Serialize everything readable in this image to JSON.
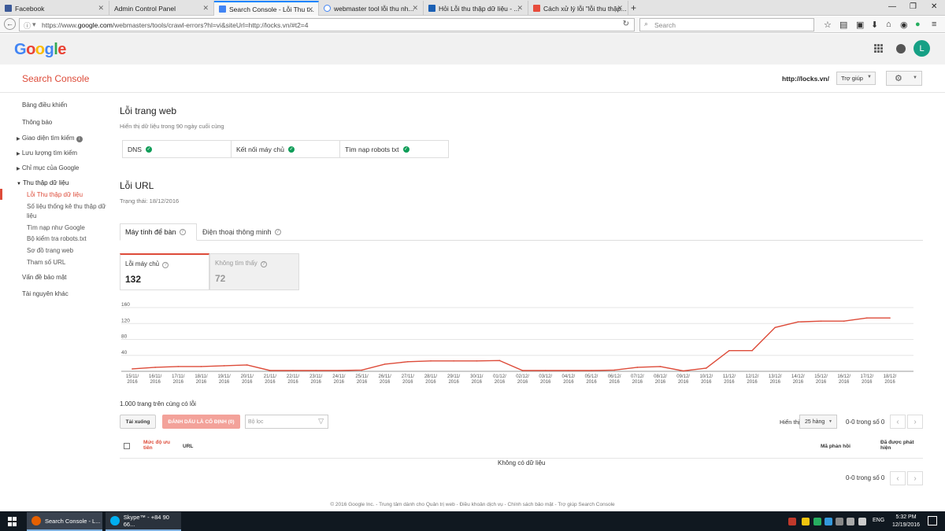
{
  "browser": {
    "tabs": [
      {
        "label": "Facebook",
        "color": "#3b5998"
      },
      {
        "label": "Admin Control Panel",
        "color": ""
      },
      {
        "label": "Search Console - Lỗi Thu t...",
        "color": "#4285f4"
      },
      {
        "label": "webmaster tool lỗi thu nh...",
        "color": "#4285f4"
      },
      {
        "label": "Hỏi Lỗi thu thập dữ liệu - ...",
        "color": "#1a5fb4"
      },
      {
        "label": "Cách xử lý lỗi \"lỗi thu thập...",
        "color": "#e74c3c"
      }
    ],
    "url_prefix": "https://www.",
    "url_host": "google.com",
    "url_rest": "/webmasters/tools/crawl-errors?hl=vi&siteUrl=http://locks.vn/#t2=4",
    "search_placeholder": "Search"
  },
  "google": {
    "logo": "Google",
    "avatar_letter": "L"
  },
  "sc": {
    "title": "Search Console",
    "site": "http://locks.vn/",
    "help": "Trợ giúp"
  },
  "sidebar": {
    "items": [
      {
        "label": "Bảng điều khiển"
      },
      {
        "label": "Thông báo"
      },
      {
        "label": "Giao diện tìm kiếm"
      },
      {
        "label": "Lưu lượng tìm kiếm"
      },
      {
        "label": "Chỉ mục của Google"
      },
      {
        "label": "Thu thập dữ liệu"
      },
      {
        "label": "Lỗi Thu thập dữ liệu"
      },
      {
        "label": "Số liệu thống kê thu thập dữ"
      },
      {
        "label": "liệu"
      },
      {
        "label": "Tìm nạp như Google"
      },
      {
        "label": "Bộ kiểm tra robots.txt"
      },
      {
        "label": "Sơ đồ trang web"
      },
      {
        "label": "Tham số URL"
      },
      {
        "label": "Vấn đề bảo mật"
      },
      {
        "label": "Tài nguyên khác"
      }
    ]
  },
  "site_errors": {
    "title": "Lỗi trang web",
    "subtitle": "Hiển thị dữ liệu trong 90 ngày cuối cùng",
    "cells": [
      "DNS",
      "Kết nối máy chủ",
      "Tìm nạp robots txt"
    ]
  },
  "url_errors": {
    "title": "Lỗi URL",
    "status": "Trạng thái: 18/12/2016",
    "tabs": [
      "Máy tính để bàn",
      "Điện thoại thông minh"
    ],
    "cards": [
      {
        "label": "Lỗi máy chủ",
        "value": "132"
      },
      {
        "label": "Không tìm thấy",
        "value": "72"
      }
    ]
  },
  "chart_data": {
    "type": "line",
    "x": [
      "15/11/2016",
      "16/11/2016",
      "17/11/2016",
      "18/11/2016",
      "19/11/2016",
      "20/11/2016",
      "21/11/2016",
      "22/11/2016",
      "23/11/2016",
      "24/11/2016",
      "25/11/2016",
      "26/11/2016",
      "27/11/2016",
      "28/11/2016",
      "29/11/2016",
      "30/11/2016",
      "01/12/2016",
      "02/12/2016",
      "03/12/2016",
      "04/12/2016",
      "05/12/2016",
      "06/12/2016",
      "07/12/2016",
      "08/12/2016",
      "09/12/2016",
      "10/12/2016",
      "11/12/2016",
      "12/12/2016",
      "13/12/2016",
      "14/12/2016",
      "15/12/2016",
      "16/12/2016",
      "17/12/2016",
      "18/12/2016"
    ],
    "tick_labels": [
      "15/11/",
      "16/11/",
      "17/11/",
      "18/11/",
      "19/11/",
      "20/11/",
      "21/11/",
      "22/11/",
      "23/11/",
      "24/11/",
      "25/11/",
      "26/11/",
      "27/11/",
      "28/11/",
      "29/11/",
      "30/11/",
      "01/12/",
      "02/12/",
      "03/12/",
      "04/12/",
      "05/12/",
      "06/12/",
      "07/12/",
      "08/12/",
      "09/12/",
      "10/12/",
      "11/12/",
      "12/12/",
      "13/12/",
      "14/12/",
      "15/12/",
      "16/12/",
      "17/12/",
      "18/12/"
    ],
    "tick_year": "2016",
    "series": [
      {
        "values": [
          6,
          10,
          12,
          12,
          14,
          16,
          2,
          2,
          2,
          2,
          3,
          18,
          24,
          26,
          26,
          26,
          27,
          2,
          2,
          2,
          2,
          3,
          10,
          12,
          1,
          8,
          52,
          52,
          110,
          124,
          126,
          126,
          134,
          134
        ]
      }
    ],
    "yticks": [
      "160",
      "120",
      "80",
      "40"
    ],
    "ylim": [
      0,
      160
    ],
    "color": "#dd4b39",
    "grid": true
  },
  "table": {
    "count_text": "1.000 trang trên cùng có lỗi",
    "download": "Tải xuống",
    "mark_fixed": "ĐÁNH DẤU LÀ CỐ ĐỊNH (0)",
    "filter_placeholder": "Bộ lọc",
    "show_label": "Hiển thị",
    "rows_value": "25 hàng",
    "range_top": "0-0 trong số 0",
    "range_bottom": "0-0 trong số 0",
    "col_priority_1": "Mức độ ưu",
    "col_priority_2": "tiên",
    "col_url": "URL",
    "col_response": "Mã phản hồi",
    "col_detected_1": "Đã được phát",
    "col_detected_2": "hiện",
    "no_data": "Không có dữ liệu"
  },
  "footer": "© 2016 Google Inc. - Trung tâm dành cho Quản trị web - Điều khoản dịch vụ - Chính sách bảo mật - Trợ giúp Search Console",
  "taskbar": {
    "apps": [
      {
        "label": "Search Console - L...",
        "color": "#e66000"
      },
      {
        "label": "Skype™ - +84 90 66...",
        "color": "#00aff0"
      }
    ],
    "lang": "ENG",
    "time": "5:32 PM",
    "date": "12/19/2016"
  }
}
